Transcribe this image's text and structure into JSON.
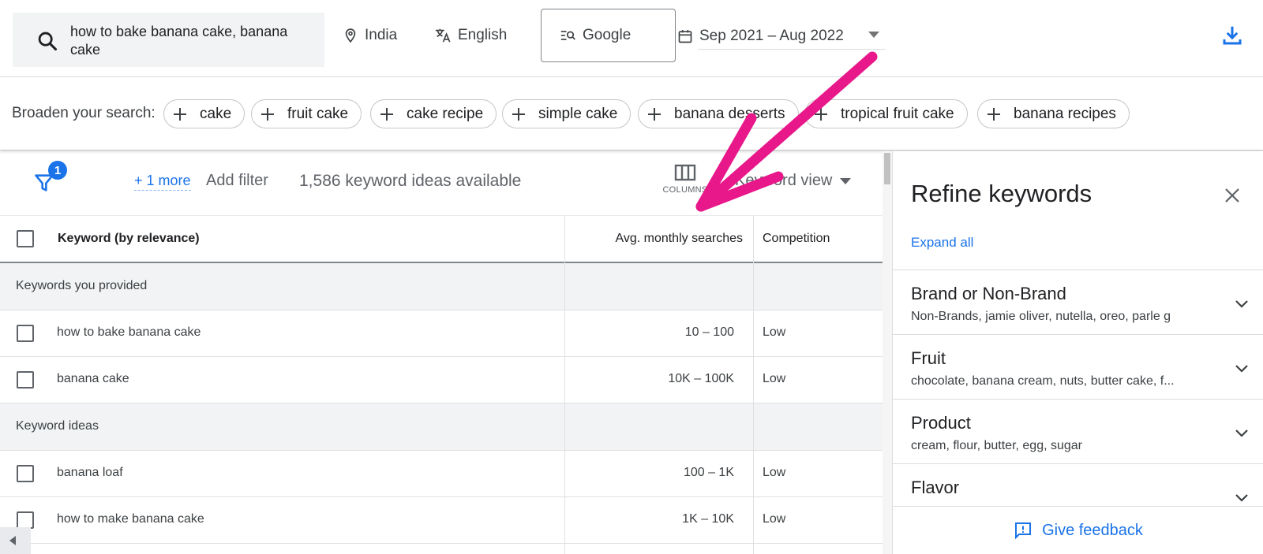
{
  "search": {
    "query": "how to bake banana cake, banana cake",
    "location": "India",
    "language": "English",
    "network": "Google",
    "date_range": "Sep 2021 – Aug 2022"
  },
  "broaden": {
    "label": "Broaden your search:",
    "chips": [
      "cake",
      "fruit cake",
      "cake recipe",
      "simple cake",
      "banana desserts",
      "tropical fruit cake",
      "banana recipes"
    ]
  },
  "toolbar": {
    "filter_count": "1",
    "more_filters": "+ 1 more",
    "add_filter": "Add filter",
    "ideas_count": "1,586 keyword ideas available",
    "columns_label": "COLUMNS",
    "view": "Keyword view"
  },
  "table": {
    "headers": {
      "keyword": "Keyword (by relevance)",
      "avg_searches": "Avg. monthly searches",
      "competition": "Competition"
    },
    "sections": [
      {
        "title": "Keywords you provided",
        "rows": [
          {
            "keyword": "how to bake banana cake",
            "avg": "10 – 100",
            "competition": "Low"
          },
          {
            "keyword": "banana cake",
            "avg": "10K – 100K",
            "competition": "Low"
          }
        ]
      },
      {
        "title": "Keyword ideas",
        "rows": [
          {
            "keyword": "banana loaf",
            "avg": "100 – 1K",
            "competition": "Low"
          },
          {
            "keyword": "how to make banana cake",
            "avg": "1K – 10K",
            "competition": "Low"
          }
        ]
      }
    ]
  },
  "refine": {
    "title": "Refine keywords",
    "expand_all": "Expand all",
    "items": [
      {
        "heading": "Brand or Non-Brand",
        "sub": "Non-Brands, jamie oliver, nutella, oreo, parle g"
      },
      {
        "heading": "Fruit",
        "sub": "chocolate, banana cream, nuts, butter cake, f..."
      },
      {
        "heading": "Product",
        "sub": "cream, flour, butter, egg, sugar"
      },
      {
        "heading": "Flavor",
        "sub": ""
      }
    ],
    "feedback": "Give feedback"
  },
  "colors": {
    "accent": "#1a73e8",
    "annotation_arrow": "#e8178a"
  }
}
